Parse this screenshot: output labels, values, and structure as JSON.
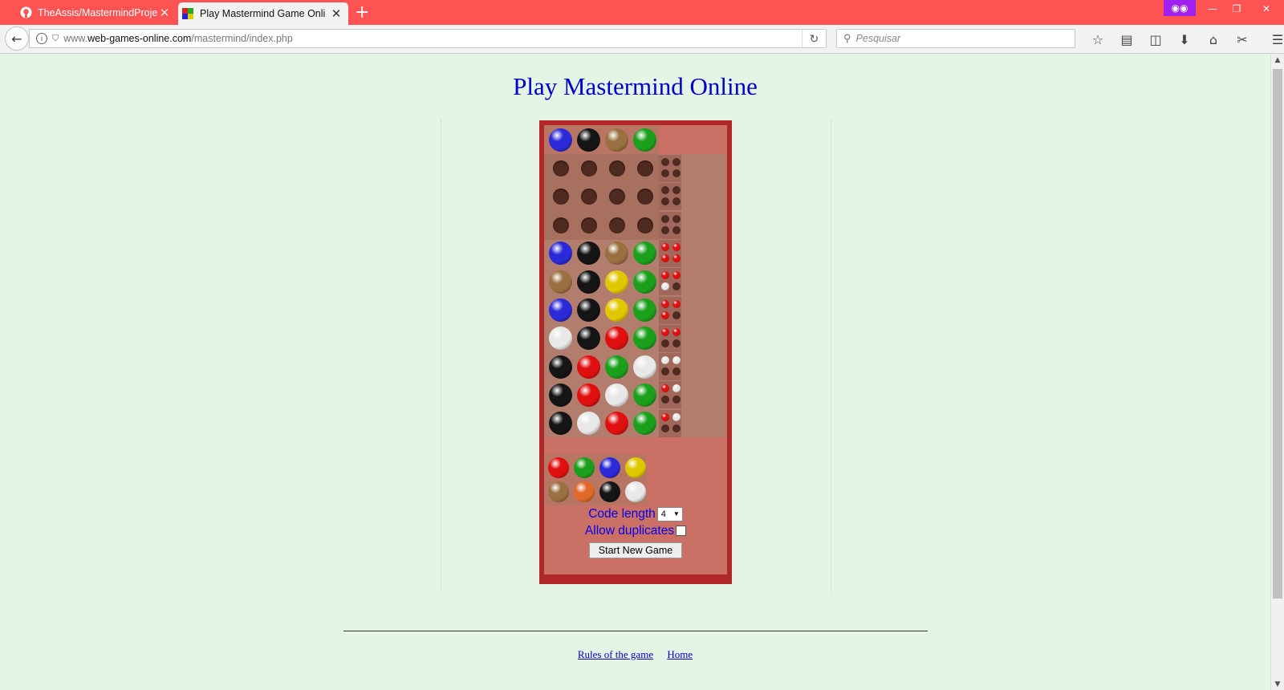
{
  "browser": {
    "tabs": [
      {
        "title": "TheAssis/MastermindProjec",
        "active": false
      },
      {
        "title": "Play Mastermind Game Onli",
        "active": true
      }
    ],
    "url_prefix": "www.",
    "url_domain": "web-games-online.com",
    "url_path": "/mastermind/index.php",
    "search_placeholder": "Pesquisar"
  },
  "page": {
    "title": "Play Mastermind Online",
    "footer_links": [
      "Rules of the game",
      "Home"
    ]
  },
  "colors": {
    "blue": "#2a2ad8",
    "black": "#151515",
    "brown": "#9a7040",
    "green": "#1ca01c",
    "yellow": "#e0c800",
    "white": "#e8e8e8",
    "red": "#e01010",
    "orange": "#e06828"
  },
  "game": {
    "secret_code": [
      "blue",
      "black",
      "brown",
      "green"
    ],
    "rows": [
      {
        "pegs": [
          null,
          null,
          null,
          null
        ],
        "feedback": [
          null,
          null,
          null,
          null
        ]
      },
      {
        "pegs": [
          null,
          null,
          null,
          null
        ],
        "feedback": [
          null,
          null,
          null,
          null
        ]
      },
      {
        "pegs": [
          null,
          null,
          null,
          null
        ],
        "feedback": [
          null,
          null,
          null,
          null
        ]
      },
      {
        "pegs": [
          "blue",
          "black",
          "brown",
          "green"
        ],
        "feedback": [
          "red",
          "red",
          "red",
          "red"
        ]
      },
      {
        "pegs": [
          "brown",
          "black",
          "yellow",
          "green"
        ],
        "feedback": [
          "red",
          "red",
          "white",
          null
        ]
      },
      {
        "pegs": [
          "blue",
          "black",
          "yellow",
          "green"
        ],
        "feedback": [
          "red",
          "red",
          "red",
          null
        ]
      },
      {
        "pegs": [
          "white",
          "black",
          "red",
          "green"
        ],
        "feedback": [
          "red",
          "red",
          null,
          null
        ]
      },
      {
        "pegs": [
          "black",
          "red",
          "green",
          "white"
        ],
        "feedback": [
          "white",
          "white",
          null,
          null
        ]
      },
      {
        "pegs": [
          "black",
          "red",
          "white",
          "green"
        ],
        "feedback": [
          "red",
          "white",
          null,
          null
        ]
      },
      {
        "pegs": [
          "black",
          "white",
          "red",
          "green"
        ],
        "feedback": [
          "red",
          "white",
          null,
          null
        ]
      }
    ],
    "palette": [
      "red",
      "green",
      "blue",
      "yellow",
      "brown",
      "orange",
      "black",
      "white"
    ]
  },
  "controls": {
    "code_length_label": "Code length",
    "code_length_value": "4",
    "allow_duplicates_label": "Allow duplicates",
    "allow_duplicates_checked": false,
    "start_button": "Start New Game"
  }
}
